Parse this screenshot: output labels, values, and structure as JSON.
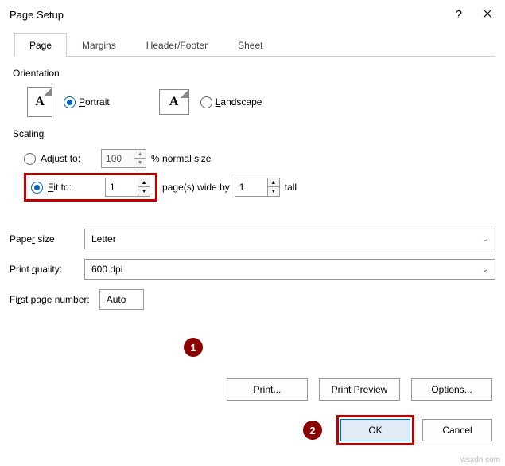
{
  "title": "Page Setup",
  "tabs": [
    "Page",
    "Margins",
    "Header/Footer",
    "Sheet"
  ],
  "orientation": {
    "label": "Orientation",
    "portrait": "Portrait",
    "landscape": "Landscape",
    "iconA": "A"
  },
  "scaling": {
    "label": "Scaling",
    "adjust_to": "Adjust to:",
    "adjust_value": "100",
    "normal_size": "% normal size",
    "fit_to": "Fit to:",
    "fit_wide": "1",
    "pages_wide_by": "page(s) wide by",
    "fit_tall": "1",
    "tall": "tall"
  },
  "paper_size": {
    "label": "Paper size:",
    "value": "Letter"
  },
  "print_quality": {
    "label": "Print quality:",
    "value": "600 dpi"
  },
  "first_page": {
    "label": "First page number:",
    "value": "Auto"
  },
  "buttons": {
    "print": "Print...",
    "preview": "Print Preview",
    "options": "Options...",
    "ok": "OK",
    "cancel": "Cancel"
  },
  "callouts": {
    "one": "1",
    "two": "2"
  },
  "watermark": "wsxdn.com"
}
